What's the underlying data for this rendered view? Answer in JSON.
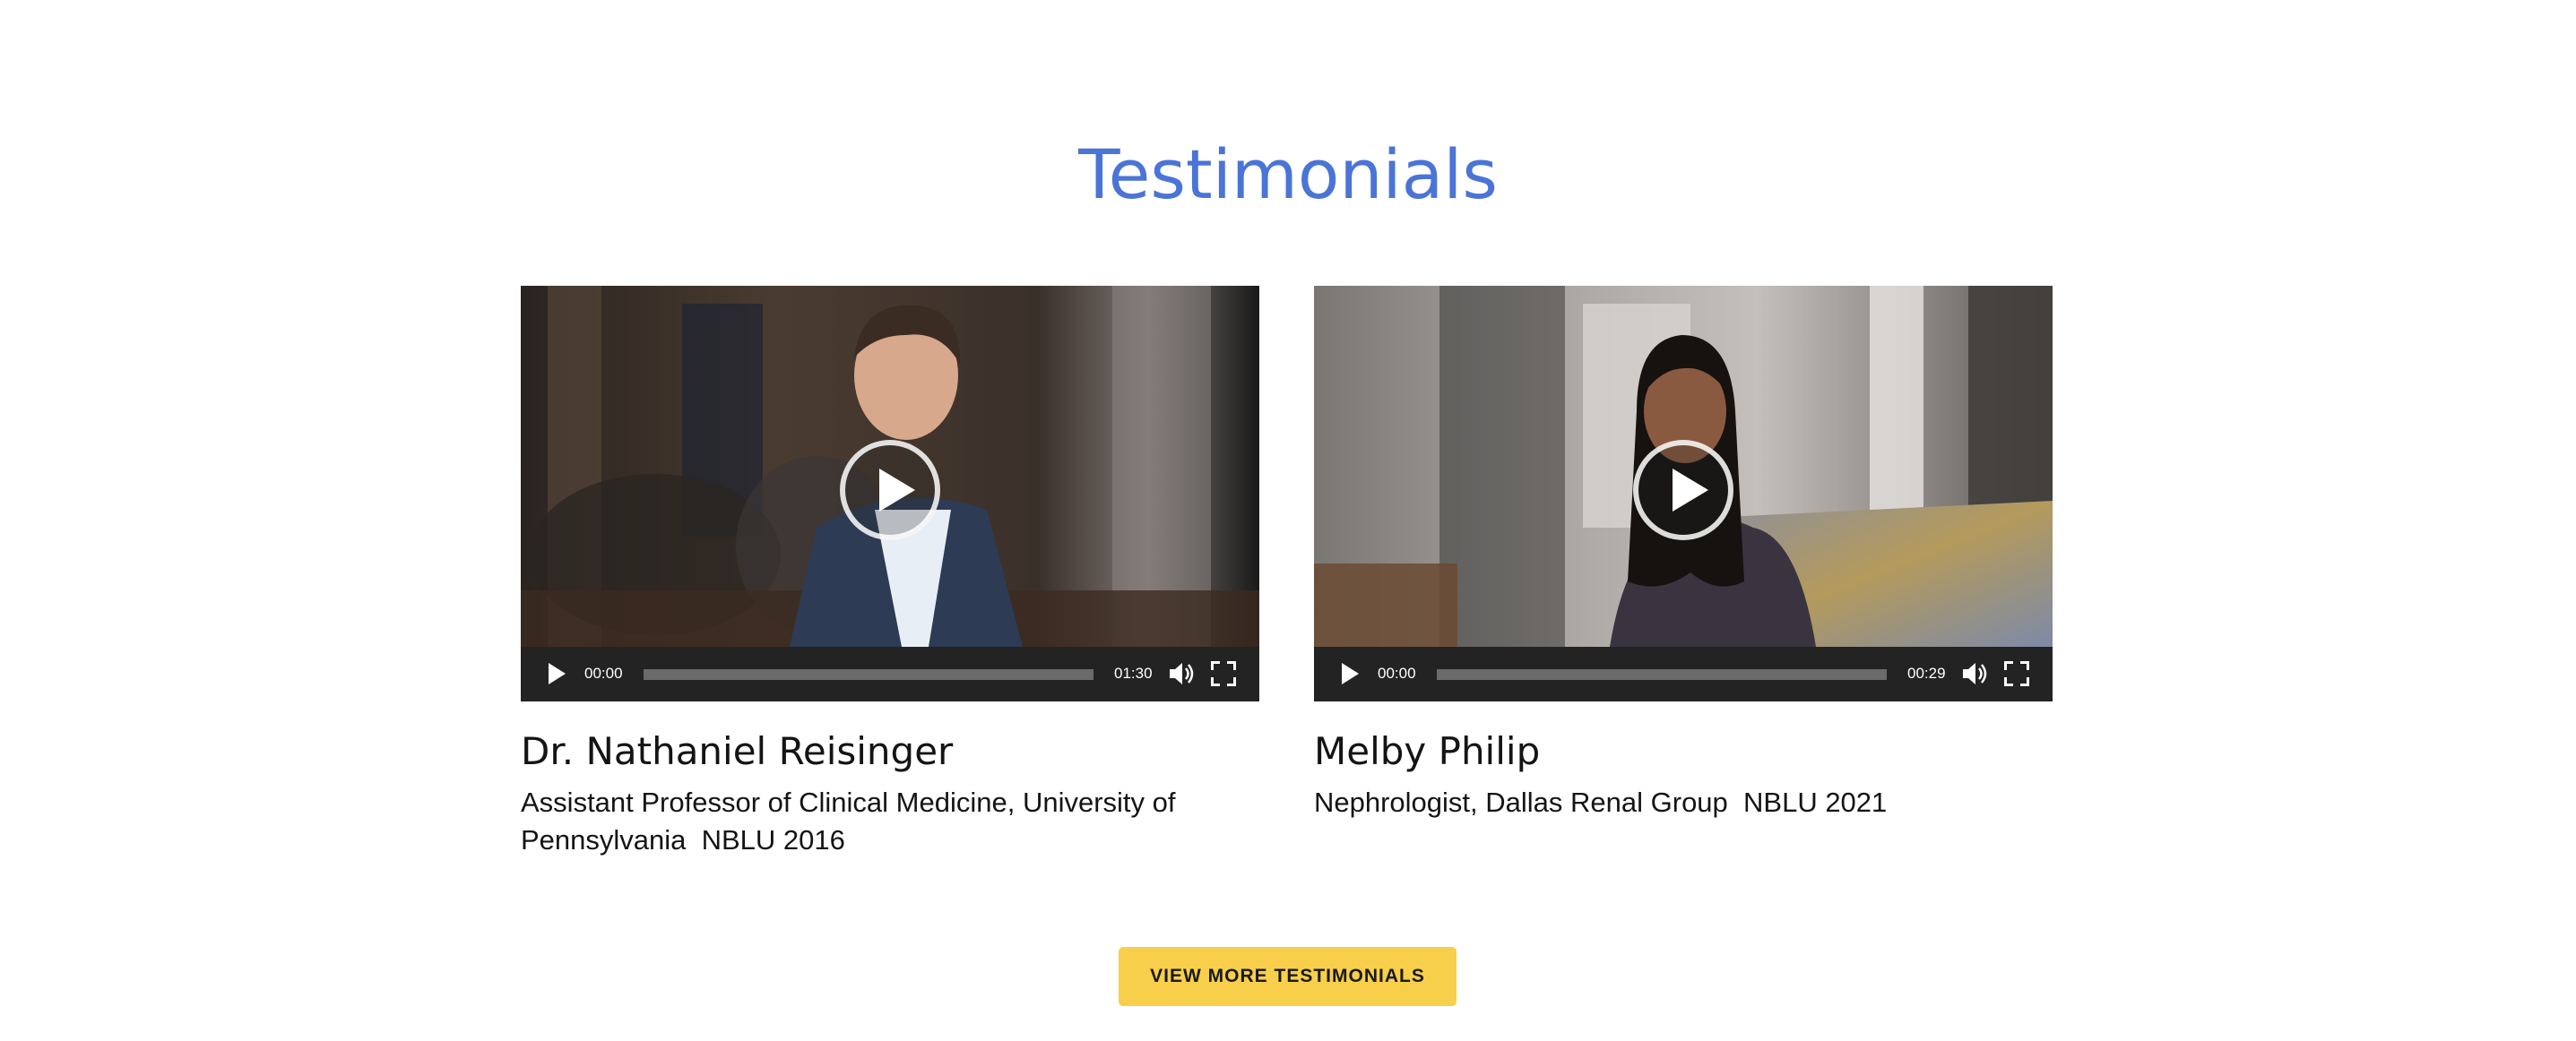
{
  "section": {
    "title": "Testimonials"
  },
  "testimonials": [
    {
      "name": "Dr. Nathaniel Reisinger",
      "description": "Assistant Professor of Clinical Medicine, University of Pennsylvania  NBLU 2016",
      "player": {
        "current_time": "00:00",
        "duration": "01:30",
        "progress": 0
      }
    },
    {
      "name": "Melby Philip",
      "description": "Nephrologist, Dallas Renal Group  NBLU 2021",
      "player": {
        "current_time": "00:00",
        "duration": "00:29",
        "progress": 0
      }
    }
  ],
  "cta": {
    "label": "VIEW MORE TESTIMONIALS"
  },
  "colors": {
    "title": "#4a74d6",
    "button": "#f7cf4a",
    "player_bar": "#232323"
  },
  "icons": [
    "play-icon",
    "volume-icon",
    "fullscreen-icon",
    "big-play-icon"
  ]
}
